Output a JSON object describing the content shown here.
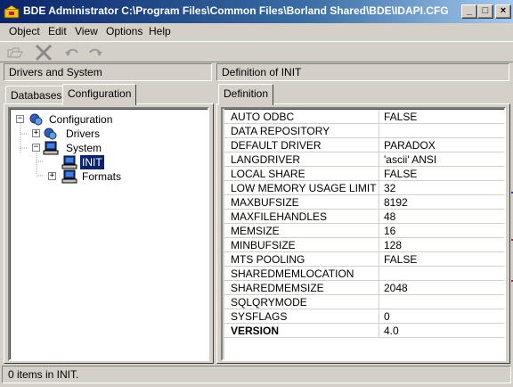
{
  "window": {
    "title": "BDE Administrator  C:\\Program Files\\Common Files\\Borland Shared\\BDE\\IDAPI.CFG",
    "minimize_glyph": "_",
    "maximize_glyph": "□",
    "close_glyph": "×"
  },
  "menu": [
    "Object",
    "Edit",
    "View",
    "Options",
    "Help"
  ],
  "toolbar": {
    "icons": [
      "open-icon",
      "delete-icon",
      "undo-icon",
      "redo-icon"
    ]
  },
  "left_pane": {
    "header": "Drivers and System",
    "tabs": [
      "Databases",
      "Configuration"
    ],
    "active_tab": "Configuration",
    "tree": [
      {
        "label": "Configuration",
        "expander": "−",
        "level": 0
      },
      {
        "label": "Drivers",
        "expander": "+",
        "level": 1
      },
      {
        "label": "System",
        "expander": "−",
        "level": 1
      },
      {
        "label": "INIT",
        "expander": "",
        "level": 2,
        "selected": true
      },
      {
        "label": "Formats",
        "expander": "+",
        "level": 2
      }
    ]
  },
  "right_pane": {
    "header": "Definition of INIT",
    "tab": "Definition",
    "rows": [
      {
        "name": "AUTO ODBC",
        "value": "FALSE"
      },
      {
        "name": "DATA REPOSITORY",
        "value": ""
      },
      {
        "name": "DEFAULT DRIVER",
        "value": "PARADOX"
      },
      {
        "name": "LANGDRIVER",
        "value": "'ascii' ANSI"
      },
      {
        "name": "LOCAL SHARE",
        "value": "FALSE"
      },
      {
        "name": "LOW MEMORY USAGE LIMIT",
        "value": "32"
      },
      {
        "name": "MAXBUFSIZE",
        "value": "8192"
      },
      {
        "name": "MAXFILEHANDLES",
        "value": "48"
      },
      {
        "name": "MEMSIZE",
        "value": "16"
      },
      {
        "name": "MINBUFSIZE",
        "value": "128"
      },
      {
        "name": "MTS POOLING",
        "value": "FALSE"
      },
      {
        "name": "SHAREDMEMLOCATION",
        "value": ""
      },
      {
        "name": "SHAREDMEMSIZE",
        "value": "2048"
      },
      {
        "name": "SQLQRYMODE",
        "value": ""
      },
      {
        "name": "SYSFLAGS",
        "value": "0"
      },
      {
        "name": "VERSION",
        "value": "4.0",
        "bold": true
      }
    ]
  },
  "status": "0 items in INIT."
}
